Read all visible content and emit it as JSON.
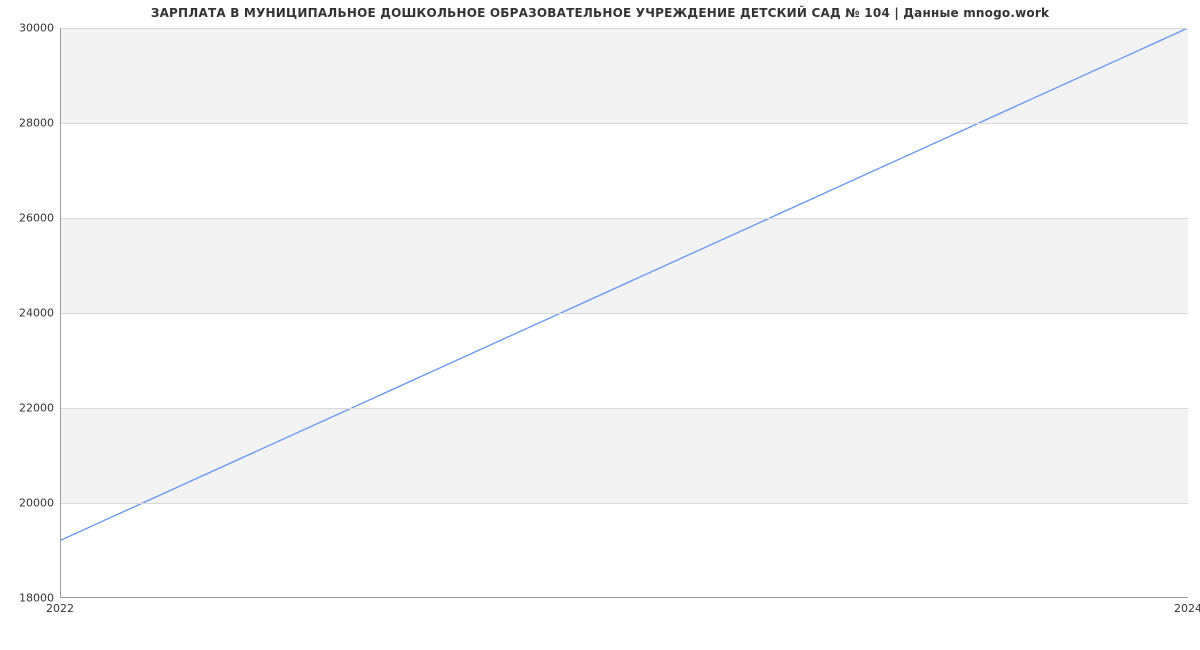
{
  "title": "ЗАРПЛАТА В МУНИЦИПАЛЬНОЕ ДОШКОЛЬНОЕ ОБРАЗОВАТЕЛЬНОЕ УЧРЕЖДЕНИЕ ДЕТСКИЙ САД № 104 | Данные mnogo.work",
  "chart_data": {
    "type": "line",
    "x": [
      2022,
      2024
    ],
    "values": [
      19200,
      30000
    ],
    "title": "ЗАРПЛАТА В МУНИЦИПАЛЬНОЕ ДОШКОЛЬНОЕ ОБРАЗОВАТЕЛЬНОЕ УЧРЕЖДЕНИЕ ДЕТСКИЙ САД № 104 | Данные mnogo.work",
    "xlabel": "",
    "ylabel": "",
    "xlim": [
      2022,
      2024
    ],
    "ylim": [
      18000,
      30000
    ],
    "yticks": [
      18000,
      20000,
      22000,
      24000,
      26000,
      28000,
      30000
    ],
    "xticks": [
      2022,
      2024
    ],
    "line_color": "#6a9bf0",
    "grid": true
  }
}
